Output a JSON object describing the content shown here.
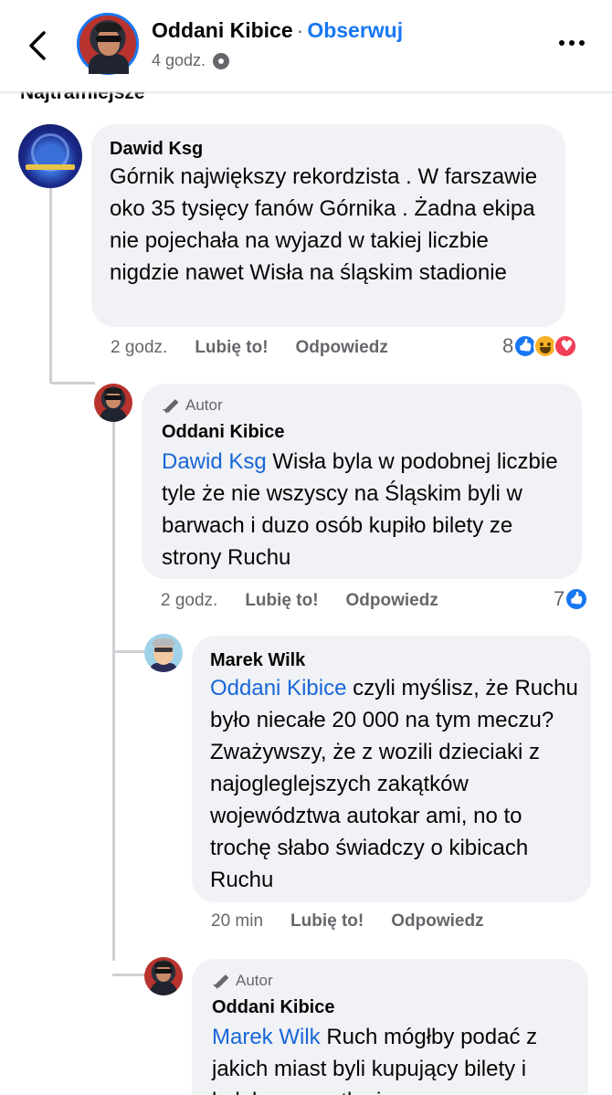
{
  "header": {
    "page_name": "Oddani Kibice",
    "separator": "·",
    "follow_label": "Obserwuj",
    "time": "4 godz."
  },
  "section_label_cut": "Najtrafniejsze",
  "comments": [
    {
      "author": "Dawid Ksg",
      "text": "Górnik największy  rekordzista . W farszawie oko 35 tysięcy fanów Górnika . Żadna ekipa nie pojechała na wyjazd w takiej liczbie nigdzie nawet Wisła na śląskim stadionie",
      "time": "2 godz.",
      "like_label": "Lubię to!",
      "reply_label": "Odpowiedz",
      "reaction_count": "8",
      "reactions": [
        "like",
        "haha",
        "love"
      ]
    },
    {
      "author_tag": "Autor",
      "author": "Oddani Kibice",
      "mention": "Dawid Ksg",
      "text": " Wisła byla w podobnej liczbie tyle że nie wszyscy na Śląskim byli w barwach i duzo osób kupiło bilety ze strony Ruchu",
      "time": "2 godz.",
      "like_label": "Lubię to!",
      "reply_label": "Odpowiedz",
      "reaction_count": "7",
      "reactions": [
        "like"
      ]
    },
    {
      "author": "Marek Wilk",
      "mention": "Oddani Kibice",
      "text": " czyli myślisz, że Ruchu było niecałe 20 000 na tym meczu? Zważywszy, że z wozili dzieciaki z najogleglejszych zakątków województwa autokar ami, no to trochę słabo świadczy o kibicach Ruchu",
      "time": "20 min",
      "like_label": "Lubię to!",
      "reply_label": "Odpowiedz"
    },
    {
      "author_tag": "Autor",
      "author": "Oddani Kibice",
      "mention": "Marek Wilk",
      "text": " Ruch mógłby podać z jakich miast byli kupujący bilety i bylaby wszystko jasne"
    }
  ],
  "icons": [
    "back-arrow-icon",
    "gear-icon",
    "more-icon",
    "pencil-icon",
    "like-reaction-icon",
    "haha-reaction-icon",
    "love-reaction-icon"
  ]
}
